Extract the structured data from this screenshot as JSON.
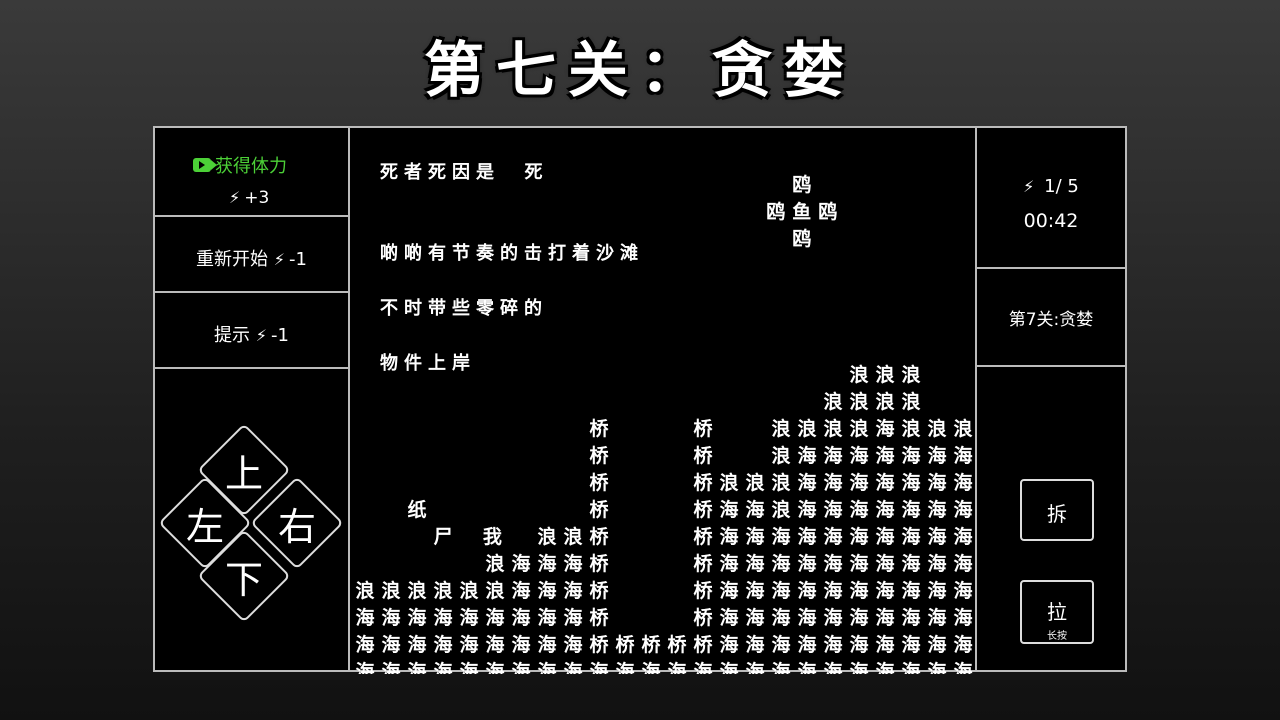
{
  "title": "第七关：贪婪",
  "left_panel": {
    "get_energy_label": "获得体力",
    "get_energy_bonus": "+3",
    "restart_label": "重新开始",
    "restart_cost": "-1",
    "hint_label": "提示",
    "hint_cost": "-1",
    "dpad": {
      "up": "上",
      "down": "下",
      "left": "左",
      "right": "右"
    }
  },
  "right_panel": {
    "energy": "1/ 5",
    "timer": "00:42",
    "level_name": "第7关:贪婪",
    "dismantle_label": "拆",
    "pull_label": "拉",
    "pull_sub": "长按"
  },
  "story": {
    "line1": "死者死因是  死",
    "line2": "啲啲有节奏的击打着沙滩",
    "line3": "不时带些零碎的",
    "line4": "物件上岸"
  },
  "board": {
    "gull": "鸥",
    "fish": "鱼",
    "wave": "浪",
    "sea": "海",
    "bridge": "桥",
    "paper": "纸",
    "corpse": "尸",
    "me": "我"
  },
  "colors": {
    "accent": "#4cd137"
  }
}
